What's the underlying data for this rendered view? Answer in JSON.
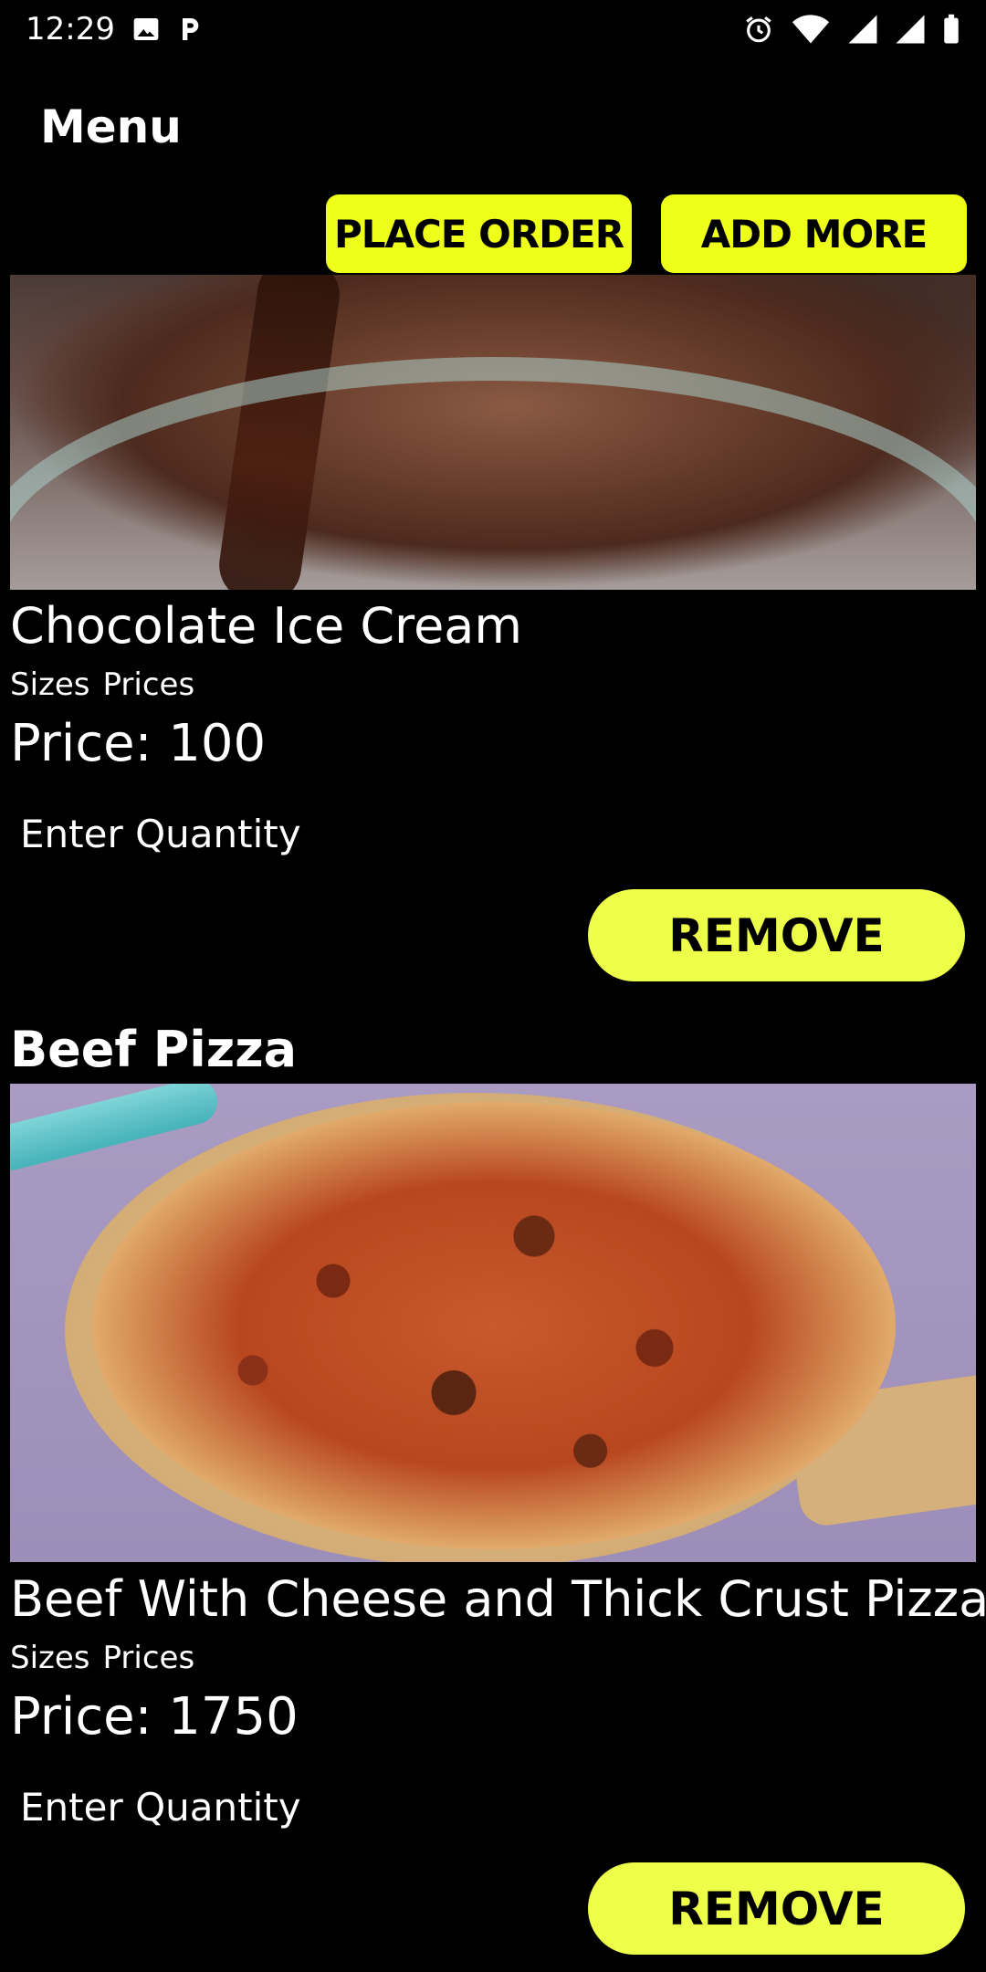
{
  "status_bar": {
    "time": "12:29",
    "icons": [
      "image-icon",
      "parking-icon",
      "alarm-icon",
      "wifi-icon",
      "signal-icon",
      "signal-icon-2",
      "battery-icon"
    ]
  },
  "app_bar": {
    "title": "Menu"
  },
  "actions": {
    "place_order_label": "PLACE ORDER",
    "add_more_label": "ADD MORE",
    "accent_color": "#eeff1a"
  },
  "items": [
    {
      "name": "Chocolate Ice Cream",
      "sizes_label": "Sizes",
      "prices_label": "Prices",
      "price_text": "Price: 100",
      "quantity_placeholder": "Enter Quantity",
      "remove_label": "REMOVE"
    },
    {
      "category": "Beef Pizza",
      "name": "Beef With Cheese and Thick Crust Pizza",
      "sizes_label": "Sizes",
      "prices_label": "Prices",
      "price_text": "Price: 1750",
      "quantity_placeholder": "Enter Quantity",
      "remove_label": "REMOVE"
    }
  ]
}
